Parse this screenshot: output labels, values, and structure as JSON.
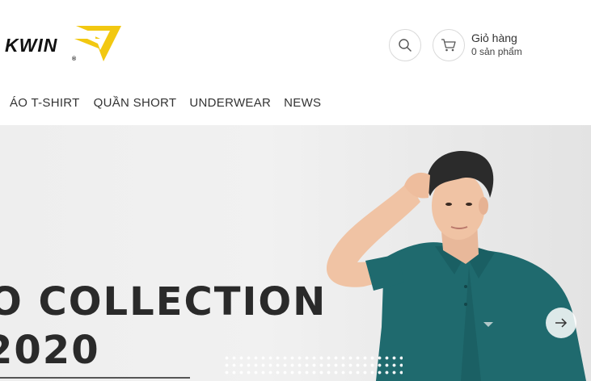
{
  "brand": {
    "logo_text": "KWIN",
    "registered_mark": "®",
    "accent_color": "#f2c811"
  },
  "header": {
    "search_icon": "search-icon",
    "cart_icon": "cart-icon",
    "cart_title": "Giỏ hàng",
    "cart_count": "0 sản phẩm"
  },
  "nav": {
    "items": [
      {
        "label": "ÁO T-SHIRT"
      },
      {
        "label": "QUẦN SHORT"
      },
      {
        "label": "UNDERWEAR"
      },
      {
        "label": "NEWS"
      }
    ]
  },
  "banner": {
    "headline": "O COLLECTION",
    "year": "2020",
    "next_icon": "arrow-right-icon",
    "shirt_color": "#1f6a6e"
  }
}
